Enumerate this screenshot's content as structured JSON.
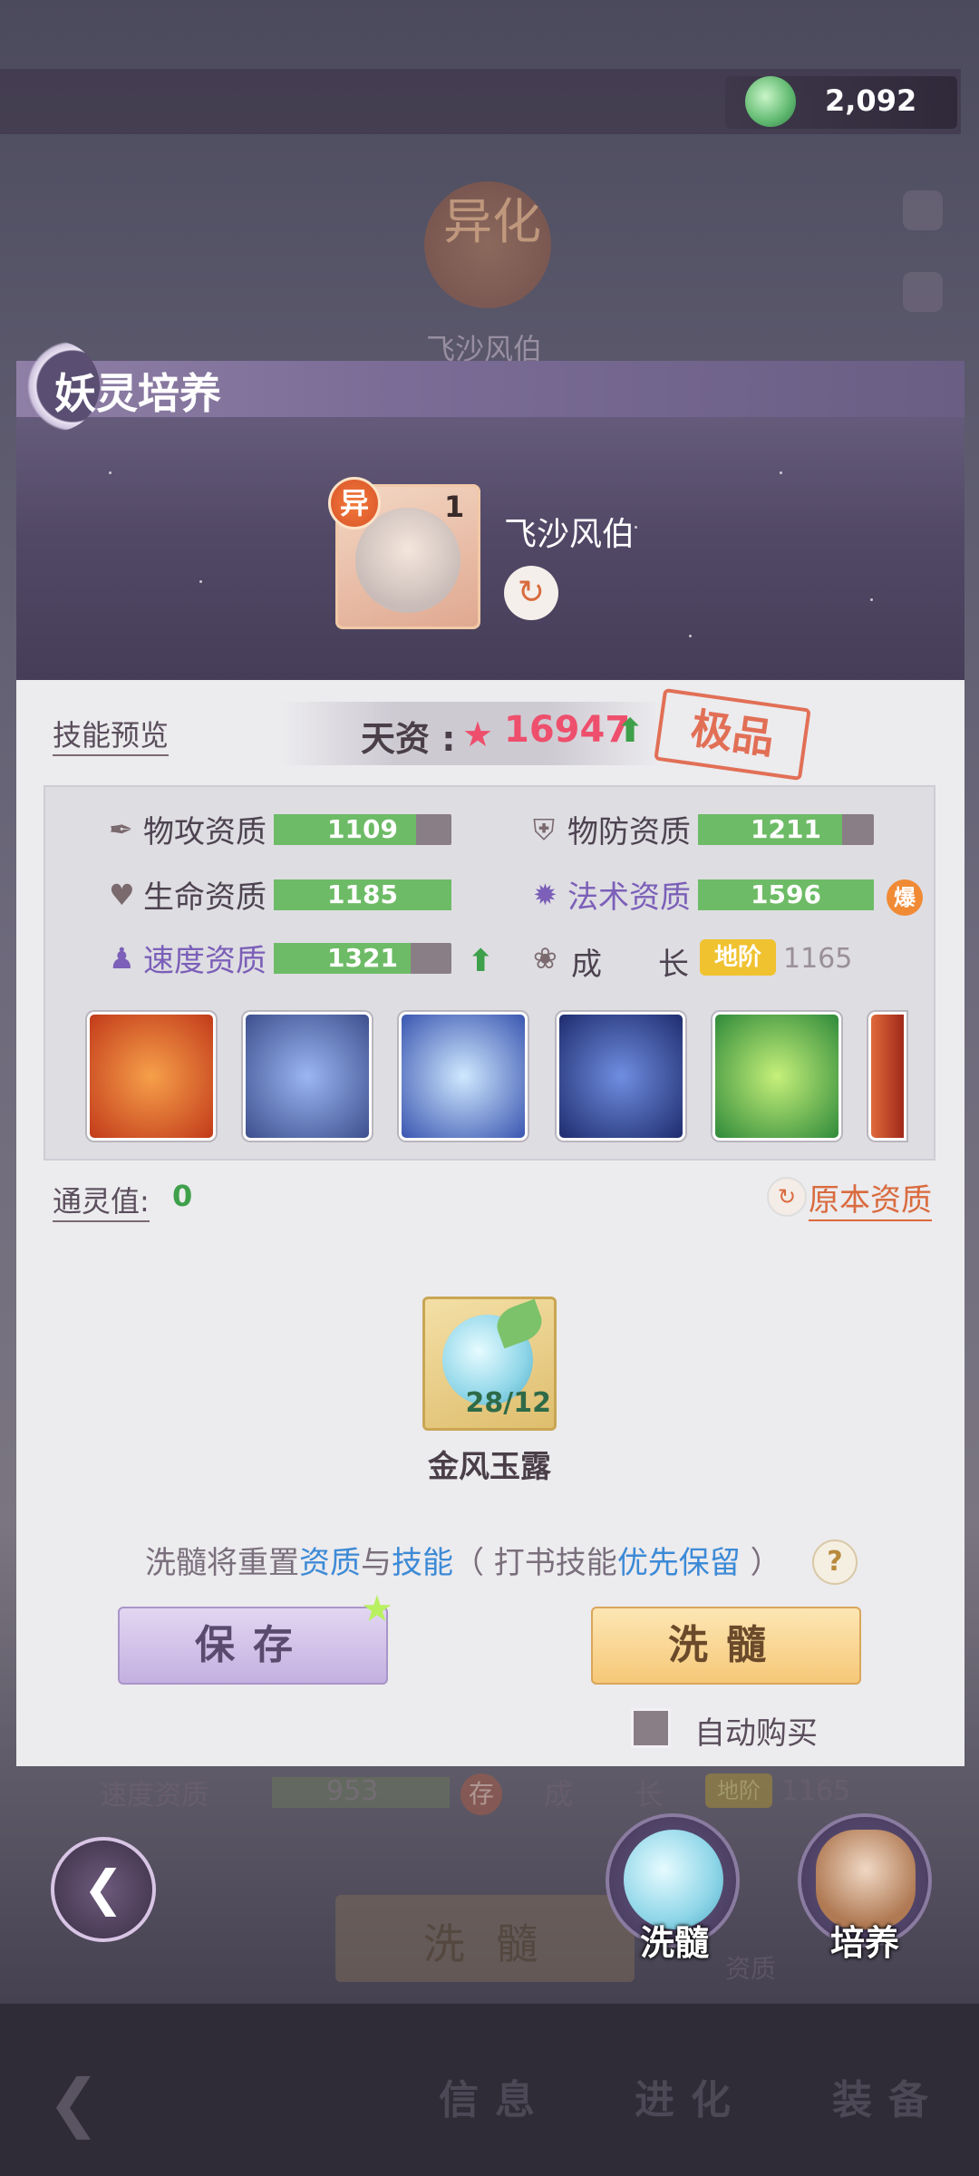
{
  "currency": {
    "icon": "jade-coin-icon",
    "value": "2,092"
  },
  "background": {
    "emblem": "异化",
    "character_name": "飞沙风伯",
    "row_label": "速度资质",
    "row_value": "953",
    "row_badge": "存",
    "row_growth": "成",
    "row_growth2": "长",
    "row_growth_tag": "地阶",
    "row_growth_val": "1165",
    "wash_label": "洗 髓",
    "zizhi": "资质",
    "nav_tabs": [
      "信息",
      "进化",
      "装备"
    ]
  },
  "panel": {
    "title": "妖灵培养",
    "character": {
      "badge": "异",
      "level": "1",
      "name": "飞沙风伯"
    },
    "skill_preview": "技能预览",
    "talent": {
      "label": "天资 :",
      "value": "16947",
      "grade": "极品"
    },
    "stats": [
      {
        "label": "物攻资质",
        "value": "1109",
        "fill": 0.8
      },
      {
        "label": "物防资质",
        "value": "1211",
        "fill": 0.82
      },
      {
        "label": "生命资质",
        "value": "1185",
        "fill": 1.0
      },
      {
        "label": "法术资质",
        "value": "1596",
        "fill": 1.0
      },
      {
        "label": "速度资质",
        "value": "1321",
        "fill": 0.77
      }
    ],
    "bao": "爆",
    "growth": {
      "label1": "成",
      "label2": "长",
      "tag": "地阶",
      "value": "1165"
    },
    "tongling": {
      "label": "通灵值:",
      "value": "0"
    },
    "original": "原本资质",
    "item": {
      "name": "金风玉露",
      "count": "28/12"
    },
    "hint": {
      "p1": "洗髓将重置",
      "h1": "资质",
      "p2": "与",
      "h2": "技能",
      "p3": "（ 打书技能",
      "h3": "优先保留",
      "p4": " ）"
    },
    "help": "?",
    "save": "保存",
    "wash": "洗髓",
    "auto_buy": "自动购买"
  },
  "actions": {
    "wash": "洗髓",
    "train": "培养"
  }
}
